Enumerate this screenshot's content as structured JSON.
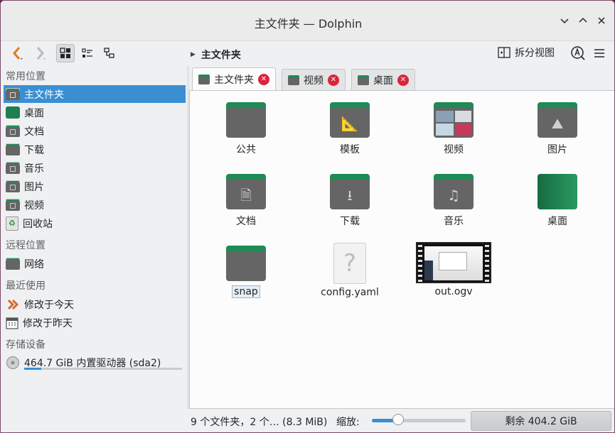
{
  "window": {
    "title": "主文件夹 — Dolphin",
    "controls": [
      "chevron-down",
      "chevron-up",
      "close"
    ]
  },
  "toolbar": {
    "breadcrumb": "主文件夹",
    "split_view_label": "拆分视图"
  },
  "sidebar": {
    "sections": {
      "places": "常用位置",
      "remote": "远程位置",
      "recent": "最近使用",
      "devices": "存储设备"
    },
    "places": [
      {
        "label": "主文件夹",
        "icon": "home-folder-icon",
        "selected": true
      },
      {
        "label": "桌面",
        "icon": "desktop-icon"
      },
      {
        "label": "文档",
        "icon": "documents-folder-icon"
      },
      {
        "label": "下载",
        "icon": "downloads-folder-icon"
      },
      {
        "label": "音乐",
        "icon": "music-folder-icon"
      },
      {
        "label": "图片",
        "icon": "pictures-folder-icon"
      },
      {
        "label": "视频",
        "icon": "videos-folder-icon"
      },
      {
        "label": "回收站",
        "icon": "trash-icon"
      }
    ],
    "remote": [
      {
        "label": "网络",
        "icon": "network-folder-icon"
      }
    ],
    "recent": [
      {
        "label": "修改于今天",
        "icon": "today-icon"
      },
      {
        "label": "修改于昨天",
        "icon": "calendar-icon"
      }
    ],
    "devices": [
      {
        "label": "464.7 GiB 内置驱动器 (sda2)",
        "icon": "drive-icon",
        "usage_fraction": 0.11
      }
    ]
  },
  "tabs": [
    {
      "label": "主文件夹",
      "active": true
    },
    {
      "label": "视频",
      "active": false
    },
    {
      "label": "桌面",
      "active": false
    }
  ],
  "files": [
    {
      "name": "公共",
      "icon": "public-folder-icon"
    },
    {
      "name": "模板",
      "icon": "templates-folder-icon"
    },
    {
      "name": "视频",
      "icon": "videos-folder-icon"
    },
    {
      "name": "图片",
      "icon": "pictures-folder-icon"
    },
    {
      "name": "文档",
      "icon": "documents-folder-icon"
    },
    {
      "name": "下载",
      "icon": "downloads-folder-icon"
    },
    {
      "name": "音乐",
      "icon": "music-folder-icon"
    },
    {
      "name": "桌面",
      "icon": "desktop-folder-icon"
    },
    {
      "name": "snap",
      "icon": "folder-icon"
    },
    {
      "name": "config.yaml",
      "icon": "unknown-file-icon"
    },
    {
      "name": "out.ogv",
      "icon": "video-file-icon"
    }
  ],
  "statusbar": {
    "summary": "9 个文件夹，2 个… (8.3 MiB)",
    "zoom_label": "缩放:",
    "zoom_fraction": 0.28,
    "free_space": "剩余 404.2 GiB"
  }
}
